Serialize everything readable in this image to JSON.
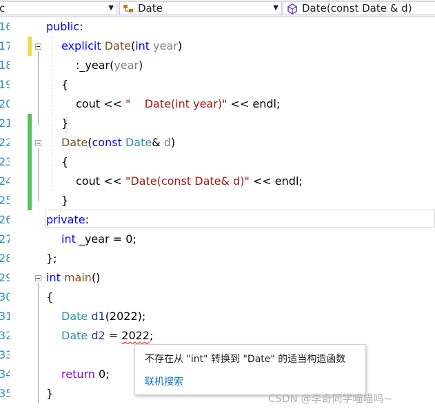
{
  "navbar": {
    "scope_fragment": "c",
    "class_dropdown": "Date",
    "member_dropdown": "Date(const Date & d)"
  },
  "editor": {
    "line_numbers": [
      "16",
      "17",
      "18",
      "19",
      "20",
      "21",
      "22",
      "23",
      "24",
      "25",
      "26",
      "27",
      "28",
      "29",
      "30",
      "31",
      "32",
      "33",
      "34",
      "35"
    ],
    "code": {
      "l16_public": "public",
      "l16_colon": ":",
      "l17_explicit": "explicit",
      "l17_date": "Date",
      "l17_open": "(",
      "l17_int": "int",
      "l17_year": "year",
      "l17_close": ")",
      "l18_init": ":_year(",
      "l18_year": "year",
      "l18_close": ")",
      "l19": "{",
      "l20_cout": "cout << ",
      "l20_str": "\"    Date(int year)\"",
      "l20_end": " << endl;",
      "l21": "}",
      "l22_date": "Date",
      "l22_open": "(",
      "l22_const": "const",
      "l22_type": "Date",
      "l22_amp": "& ",
      "l22_d": "d",
      "l22_close": ")",
      "l23": "{",
      "l24_cout": "cout << ",
      "l24_str": "\"Date(const Date& d)\"",
      "l24_end": " << endl;",
      "l25": "}",
      "l26_private": "private",
      "l26_colon": ":",
      "l27_int": "int",
      "l27_rest": " _year = 0;",
      "l28": "};",
      "l29_int": "int",
      "l29_main": "main",
      "l29_paren": "()",
      "l30": "{",
      "l31_type": "Date",
      "l31_var": "d1",
      "l31_rest": "(2022);",
      "l32_type": "Date",
      "l32_var": "d2",
      "l32_eq": " = ",
      "l32_num": "2022",
      "l32_semi": ";",
      "l34_return": "return",
      "l34_rest": " 0;",
      "l35": "}"
    }
  },
  "tooltip": {
    "message": "不存在从 \"int\" 转换到 \"Date\" 的适当构造函数",
    "search_link": "联机搜索"
  },
  "watermark": "CSDN @李奇同学喵喵呜~",
  "colors": {
    "keyword": "#0000ff",
    "control_keyword": "#8f08c4",
    "type": "#2b91af",
    "function": "#74531f",
    "string": "#a31515",
    "error": "#e51400",
    "change_saved": "#57c25c",
    "change_unsaved": "#f0d94a"
  }
}
